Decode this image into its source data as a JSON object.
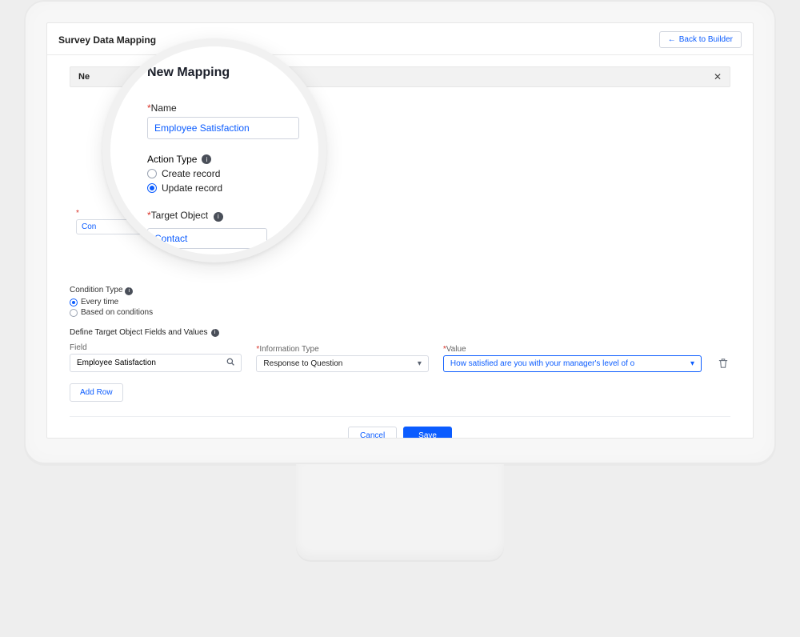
{
  "header": {
    "page_title": "Survey Data Mapping",
    "back_button": "Back to Builder"
  },
  "section": {
    "bar_title_truncated": "Ne"
  },
  "behind": {
    "small_field_truncated": "Con"
  },
  "condition": {
    "label": "Condition Type",
    "options": {
      "every_time": "Every time",
      "based_on": "Based on conditions"
    },
    "selected": "every_time"
  },
  "define": {
    "label": "Define Target Object Fields and Values"
  },
  "row": {
    "field_label": "Field",
    "field_value": "Employee Satisfaction",
    "info_type_label": "Information Type",
    "info_type_value": "Response to Question",
    "value_label": "Value",
    "value_value": "How satisfied are you with your manager's level of o"
  },
  "buttons": {
    "add_row": "Add Row",
    "cancel": "Cancel",
    "save": "Save"
  },
  "magnifier": {
    "title": "New Mapping",
    "name_label": "Name",
    "name_value": "Employee Satisfaction",
    "action_type_label": "Action Type",
    "opt_create": "Create record",
    "opt_update": "Update record",
    "action_selected": "update",
    "target_label": "Target Object",
    "target_value": "Contact"
  }
}
